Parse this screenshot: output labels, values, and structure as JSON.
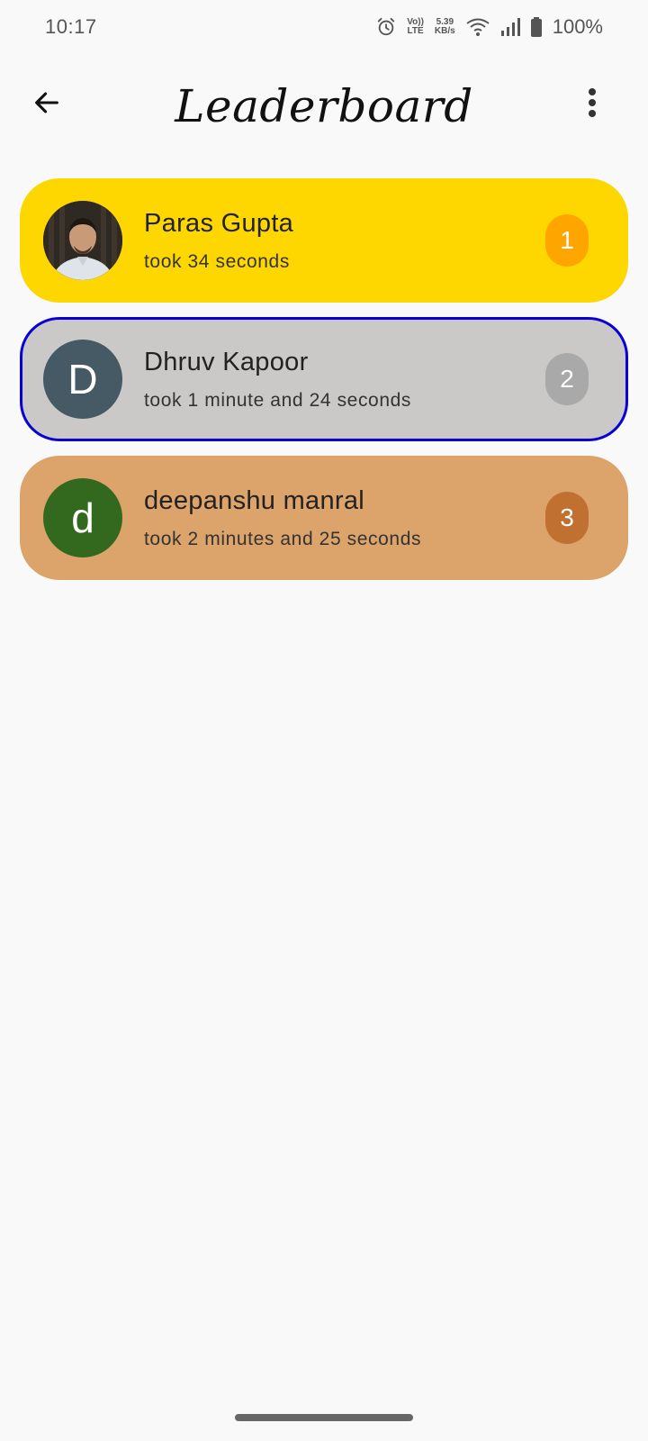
{
  "status_bar": {
    "time": "10:17",
    "volte_top": "Vo))",
    "volte_bottom": "LTE",
    "speed_value": "5.39",
    "speed_unit": "KB/s",
    "battery": "100%"
  },
  "app_bar": {
    "title": "Leaderboard",
    "back_icon": "arrow-back-icon",
    "menu_icon": "more-vert-icon"
  },
  "entries": [
    {
      "name": "Paras Gupta",
      "time_text": "took 34 seconds",
      "rank": "1",
      "avatar_type": "photo",
      "card_color": "#ffd700",
      "rank_color": "#ffa500"
    },
    {
      "name": "Dhruv Kapoor",
      "time_text": "took 1 minute and 24 seconds",
      "rank": "2",
      "avatar_letter": "D",
      "avatar_color": "#455a64",
      "card_color": "#cbc8c8",
      "rank_color": "#a9a9a9",
      "highlighted": true,
      "highlight_color": "#0a00d4"
    },
    {
      "name": "deepanshu manral",
      "time_text": "took 2 minutes and 25 seconds",
      "rank": "3",
      "avatar_letter": "d",
      "avatar_color": "#33691e",
      "card_color": "#dca46a",
      "rank_color": "#c07030"
    }
  ]
}
